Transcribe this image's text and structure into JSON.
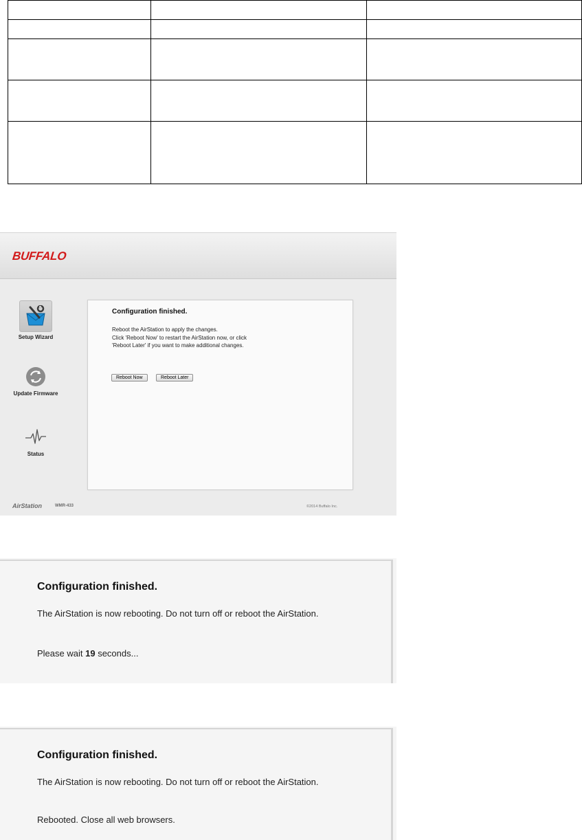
{
  "ui": {
    "logo_text": "BUFFALO",
    "sidebar": {
      "items": [
        {
          "label": "Setup Wizard",
          "icon": "setup-wizard-icon"
        },
        {
          "label": "Update Firmware",
          "icon": "update-firmware-icon"
        },
        {
          "label": "Status",
          "icon": "status-icon"
        }
      ]
    },
    "content": {
      "title": "Configuration finished.",
      "lines": [
        "Reboot the AirStation to apply the changes.",
        "Click 'Reboot Now' to restart the AirStation now, or click",
        "'Reboot Later' if you want to make additional changes."
      ],
      "reboot_now_label": "Reboot Now",
      "reboot_later_label": "Reboot Later"
    },
    "footer": {
      "brand": "AirStation",
      "model": "WMR-433",
      "copyright": "©2014 Buffalo Inc."
    }
  },
  "panel_rebooting": {
    "title": "Configuration finished.",
    "message": "The AirStation is now rebooting. Do not turn off or reboot the AirStation.",
    "wait_prefix": "Please wait",
    "seconds": "19",
    "wait_suffix": "seconds..."
  },
  "panel_rebooted": {
    "title": "Configuration finished.",
    "message": "The AirStation is now rebooting. Do not turn off or reboot the AirStation.",
    "done_message": "Rebooted. Close all web browsers."
  },
  "colors": {
    "brand_red": "#d21a1a",
    "wizard_blue": "#1d8fd6"
  }
}
